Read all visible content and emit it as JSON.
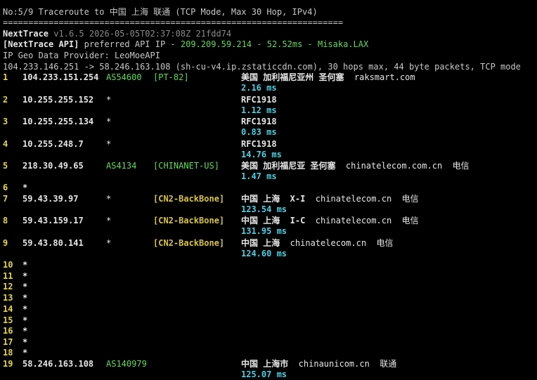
{
  "header": {
    "title": "No:5/9 Traceroute to 中国 上海 联通 (TCP Mode, Max 30 Hop, IPv4)",
    "separator": "===================================================================",
    "app_name": "NextTrace",
    "app_version": "v1.6.5 2026-05-05T02:37:08Z 21fdd74",
    "api_label": "[NextTrace API]",
    "api_text": " preferred API IP - ",
    "api_ip": "209.209.59.214",
    "api_dash1": " - ",
    "api_latency": "52.52ms",
    "api_dash2": " - ",
    "api_node": "Misaka.LAX",
    "geo_provider": "IP Geo Data Provider: LeoMoeAPI",
    "route_summary": "104.233.146.251 -> 58.246.163.108 (sh-cu-v4.ip.zstaticcdn.com), 30 hops max, 44 byte packets, TCP mode"
  },
  "hops": [
    {
      "num": "1",
      "ip": "104.233.151.254",
      "asn": "AS54600",
      "tag": "[PT-82]",
      "geo": "美国 加利福尼亚州 圣何塞",
      "domain": "raksmart.com",
      "isp": "",
      "rtt": "2.16 ms"
    },
    {
      "num": "2",
      "ip": "10.255.255.152",
      "asn": "*",
      "tag": "",
      "geo": "RFC1918",
      "domain": "",
      "isp": "",
      "rtt": "1.12 ms"
    },
    {
      "num": "3",
      "ip": "10.255.255.134",
      "asn": "*",
      "tag": "",
      "geo": "RFC1918",
      "domain": "",
      "isp": "",
      "rtt": "0.83 ms"
    },
    {
      "num": "4",
      "ip": "10.255.248.7",
      "asn": "*",
      "tag": "",
      "geo": "RFC1918",
      "domain": "",
      "isp": "",
      "rtt": "14.76 ms"
    },
    {
      "num": "5",
      "ip": "218.30.49.65",
      "asn": "AS4134",
      "tag": "[CHINANET-US]",
      "geo": "美国 加利福尼亚 圣何塞",
      "domain": "chinatelecom.com.cn",
      "isp": "电信",
      "rtt": "1.47 ms"
    },
    {
      "num": "6",
      "ip": "*"
    },
    {
      "num": "7",
      "ip": "59.43.39.97",
      "asn": "*",
      "tag": "[CN2-BackBone]",
      "geo": "中国 上海  X-I",
      "domain": "chinatelecom.cn",
      "isp": "电信",
      "rtt": "123.54 ms"
    },
    {
      "num": "8",
      "ip": "59.43.159.17",
      "asn": "*",
      "tag": "[CN2-BackBone]",
      "geo": "中国 上海  I-C",
      "domain": "chinatelecom.cn",
      "isp": "电信",
      "rtt": "131.95 ms"
    },
    {
      "num": "9",
      "ip": "59.43.80.141",
      "asn": "*",
      "tag": "[CN2-BackBone]",
      "geo": "中国 上海",
      "domain": "chinatelecom.cn",
      "isp": "电信",
      "rtt": "124.60 ms"
    },
    {
      "num": "10",
      "ip": "*"
    },
    {
      "num": "11",
      "ip": "*"
    },
    {
      "num": "12",
      "ip": "*"
    },
    {
      "num": "13",
      "ip": "*"
    },
    {
      "num": "14",
      "ip": "*"
    },
    {
      "num": "15",
      "ip": "*"
    },
    {
      "num": "16",
      "ip": "*"
    },
    {
      "num": "17",
      "ip": "*"
    },
    {
      "num": "18",
      "ip": "*"
    },
    {
      "num": "19",
      "ip": "58.246.163.108",
      "asn": "AS140979",
      "tag": "",
      "geo": "中国 上海市",
      "domain": "chinaunicom.cn",
      "isp": "联通",
      "rtt": "125.07 ms"
    }
  ],
  "colors": {
    "hop_number": "#e5d54d",
    "asn": "#66d95f",
    "tag_green": "#66d95f",
    "tag_backbone": "#d8c446",
    "rtt": "#4fd0e0"
  }
}
